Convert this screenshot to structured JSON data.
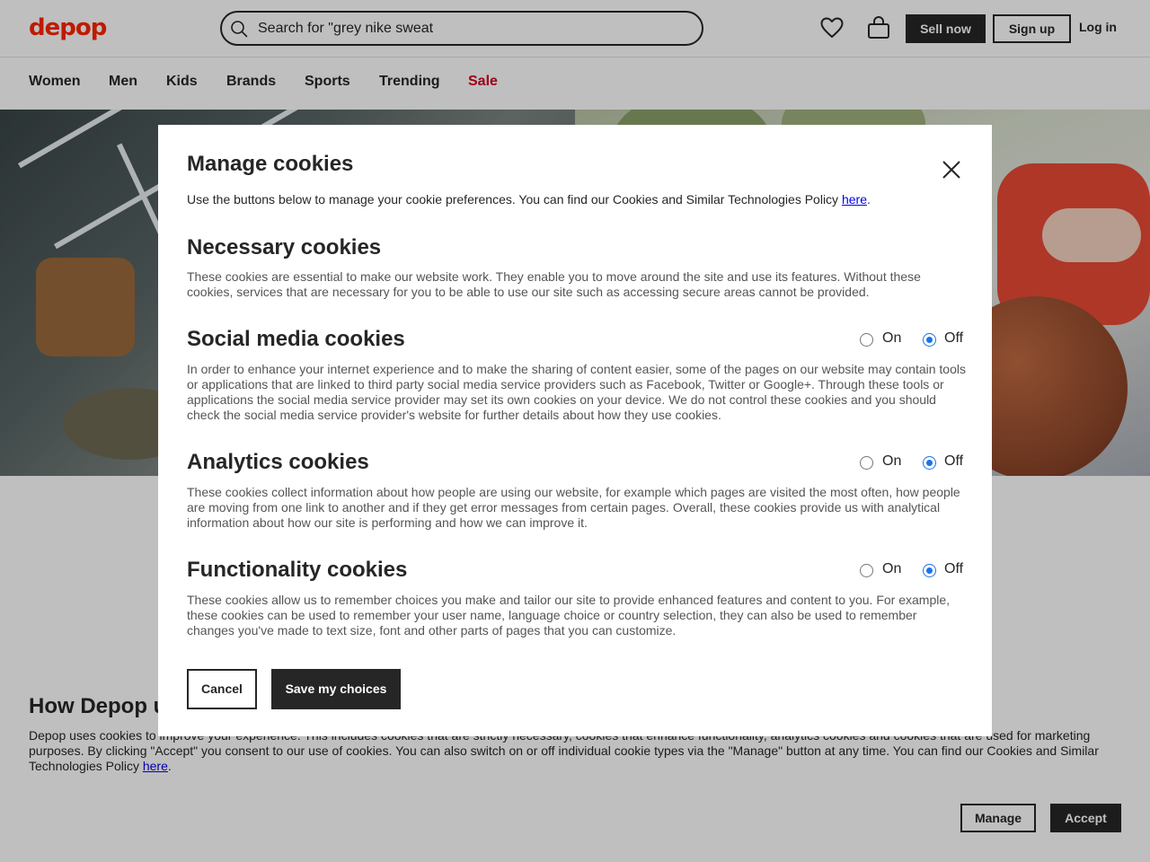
{
  "header": {
    "logo": "depop",
    "search_placeholder": "Search for \"grey nike sweat",
    "sell_label": "Sell now",
    "signup_label": "Sign up",
    "login_label": "Log in"
  },
  "nav": {
    "items": [
      "Women",
      "Men",
      "Kids",
      "Brands",
      "Sports",
      "Trending",
      "Sale"
    ]
  },
  "banner": {
    "title": "How Depop uses cookies",
    "text_before_link": "Depop uses cookies to improve your experience. This includes cookies that are strictly necessary, cookies that enhance functionality, analytics cookies and cookies that are used for marketing purposes. By clicking \"Accept\" you consent to our use of cookies. You can also switch on or off individual cookie types via the \"Manage\" button at any time. You can find our Cookies and Similar Technologies Policy ",
    "link_text": "here",
    "text_after_link": ".",
    "manage_label": "Manage",
    "accept_label": "Accept"
  },
  "modal": {
    "title": "Manage cookies",
    "intro_before_link": "Use the buttons below to manage your cookie preferences. You can find our Cookies and Similar Technologies Policy ",
    "intro_link": "here",
    "intro_after_link": ".",
    "on_label": "On",
    "off_label": "Off",
    "sections": [
      {
        "title": "Necessary cookies",
        "text": "These cookies are essential to make our website work. They enable you to move around the site and use its features. Without these cookies, services that are necessary for you to be able to use our site such as accessing secure areas cannot be provided."
      },
      {
        "title": "Social media cookies",
        "text": "In order to enhance your internet experience and to make the sharing of content easier, some of the pages on our website may contain tools or applications that are linked to third party social media service providers such as Facebook, Twitter or Google+. Through these tools or applications the social media service provider may set its own cookies on your device. We do not control these cookies and you should check the social media service provider's website for further details about how they use cookies.",
        "selected": "Off"
      },
      {
        "title": "Analytics cookies",
        "text": "These cookies collect information about how people are using our website, for example which pages are visited the most often, how people are moving from one link to another and if they get error messages from certain pages. Overall, these cookies provide us with analytical information about how our site is performing and how we can improve it.",
        "selected": "Off"
      },
      {
        "title": "Functionality cookies",
        "text": "These cookies allow us to remember choices you make and tailor our site to provide enhanced features and content to you. For example, these cookies can be used to remember your user name, language choice or country selection, they can also be used to remember changes you've made to text size, font and other parts of pages that you can customize.",
        "selected": "Off"
      }
    ],
    "cancel_label": "Cancel",
    "save_label": "Save my choices"
  },
  "colors": {
    "brand": "#ff2300",
    "sale": "#d3001c",
    "dark": "#262626",
    "radio_selected": "#1a73e8"
  }
}
